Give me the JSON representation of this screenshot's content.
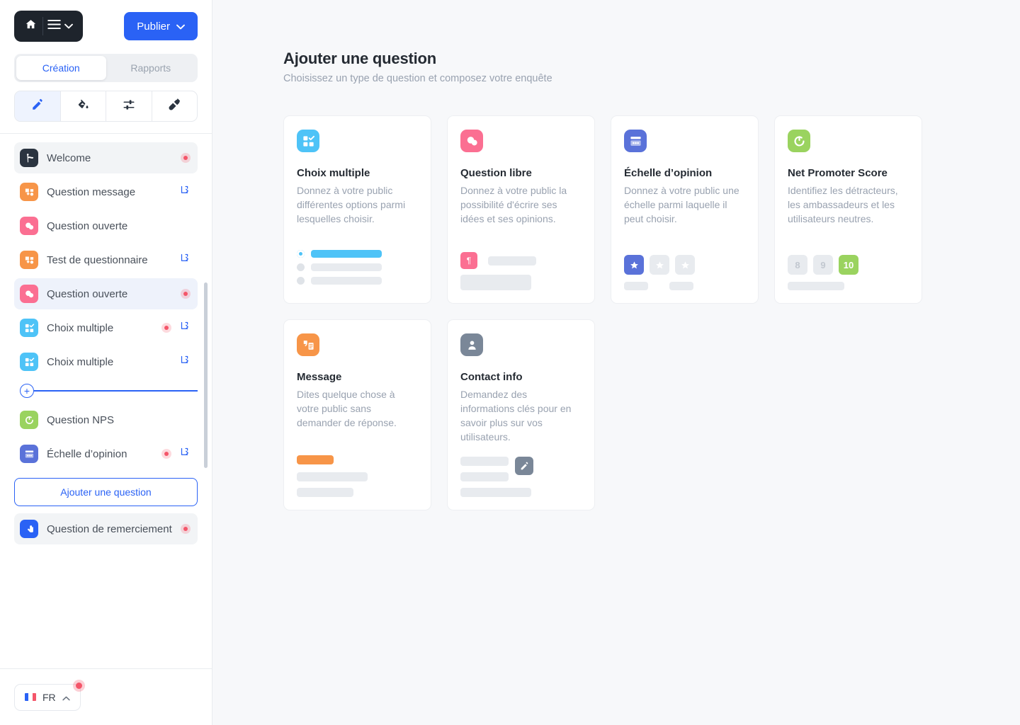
{
  "header": {
    "home_icon": "home-icon",
    "menu_icon": "hamburger-menu-icon",
    "menu_chevron_icon": "chevron-down-icon",
    "publish_label": "Publier",
    "publish_chevron_icon": "chevron-down-icon"
  },
  "tabs": [
    {
      "label": "Création",
      "active": true
    },
    {
      "label": "Rapports",
      "active": false
    }
  ],
  "tools": [
    {
      "name": "pencil-icon",
      "active": true
    },
    {
      "name": "paint-bucket-icon",
      "active": false
    },
    {
      "name": "sliders-icon",
      "active": false
    },
    {
      "name": "plug-connect-icon",
      "active": false
    }
  ],
  "questions": [
    {
      "label": "Welcome",
      "icon": "welcome-icon",
      "color": "#2b3440",
      "selected": "grey",
      "dot": true,
      "logic": false
    },
    {
      "label": "Question message",
      "icon": "message-icon",
      "color": "#f79548",
      "selected": "",
      "dot": false,
      "logic": true
    },
    {
      "label": "Question ouverte",
      "icon": "open-question-icon",
      "color": "#fb6f92",
      "selected": "",
      "dot": false,
      "logic": false
    },
    {
      "label": "Test de questionnaire",
      "icon": "message-icon",
      "color": "#f79548",
      "selected": "",
      "dot": false,
      "logic": true
    },
    {
      "label": "Question ouverte",
      "icon": "open-question-icon",
      "color": "#fb6f92",
      "selected": "blue",
      "dot": true,
      "logic": false
    },
    {
      "label": "Choix multiple",
      "icon": "multiple-choice-icon",
      "color": "#4ec3f7",
      "selected": "",
      "dot": true,
      "logic": true
    },
    {
      "label": "Choix multiple",
      "icon": "multiple-choice-icon",
      "color": "#4ec3f7",
      "selected": "",
      "dot": false,
      "logic": true
    },
    {
      "label": "Question NPS",
      "icon": "nps-icon",
      "color": "#9ad35f",
      "selected": "",
      "dot": false,
      "logic": false
    },
    {
      "label": "Échelle d’opinion",
      "icon": "opinion-scale-icon",
      "color": "#5a72d9",
      "selected": "",
      "dot": true,
      "logic": true
    }
  ],
  "insert_divider": {
    "icon": "plus-circle-icon"
  },
  "add_question_label": "Ajouter une question",
  "thankyou": {
    "label": "Question de remerciement",
    "icon": "thankyou-icon",
    "color": "#2a62f5",
    "dot": true
  },
  "footer": {
    "lang_label": "FR",
    "chevron_icon": "chevron-up-icon",
    "flag": "french-flag-icon",
    "has_notification": true
  },
  "main": {
    "title": "Ajouter une question",
    "subtitle": "Choisissez un type de question et composez votre enquête",
    "cards": [
      {
        "title": "Choix multiple",
        "desc": "Donnez à votre public différentes options parmi lesquelles choisir.",
        "icon": "multiple-choice-icon",
        "color": "#4ec3f7",
        "preview": "radio-list"
      },
      {
        "title": "Question libre",
        "desc": "Donnez à votre public la possibilité d'écrire ses idées et ses opinions.",
        "icon": "open-question-icon",
        "color": "#fb6f92",
        "preview": "paragraph"
      },
      {
        "title": "Échelle d’opinion",
        "desc": "Donnez à votre public une échelle parmi laquelle il peut choisir.",
        "icon": "opinion-scale-icon",
        "color": "#5a72d9",
        "preview": "stars",
        "stars": 3,
        "stars_selected": 1
      },
      {
        "title": "Net Promoter Score",
        "desc": "Identifiez les détracteurs, les ambassadeurs et les utilisateurs neutres.",
        "icon": "nps-icon",
        "color": "#9ad35f",
        "preview": "numbers",
        "numbers": [
          "8",
          "9",
          "10"
        ],
        "number_selected": "10"
      },
      {
        "title": "Message",
        "desc": "Dites quelque chose à votre public sans demander de réponse.",
        "icon": "quote-message-icon",
        "color": "#f79548",
        "preview": "message"
      },
      {
        "title": "Contact info",
        "desc": "Demandez des informations clés pour en savoir plus sur vos utilisateurs.",
        "icon": "contact-person-icon",
        "color": "#7a8798",
        "preview": "contact"
      }
    ]
  }
}
